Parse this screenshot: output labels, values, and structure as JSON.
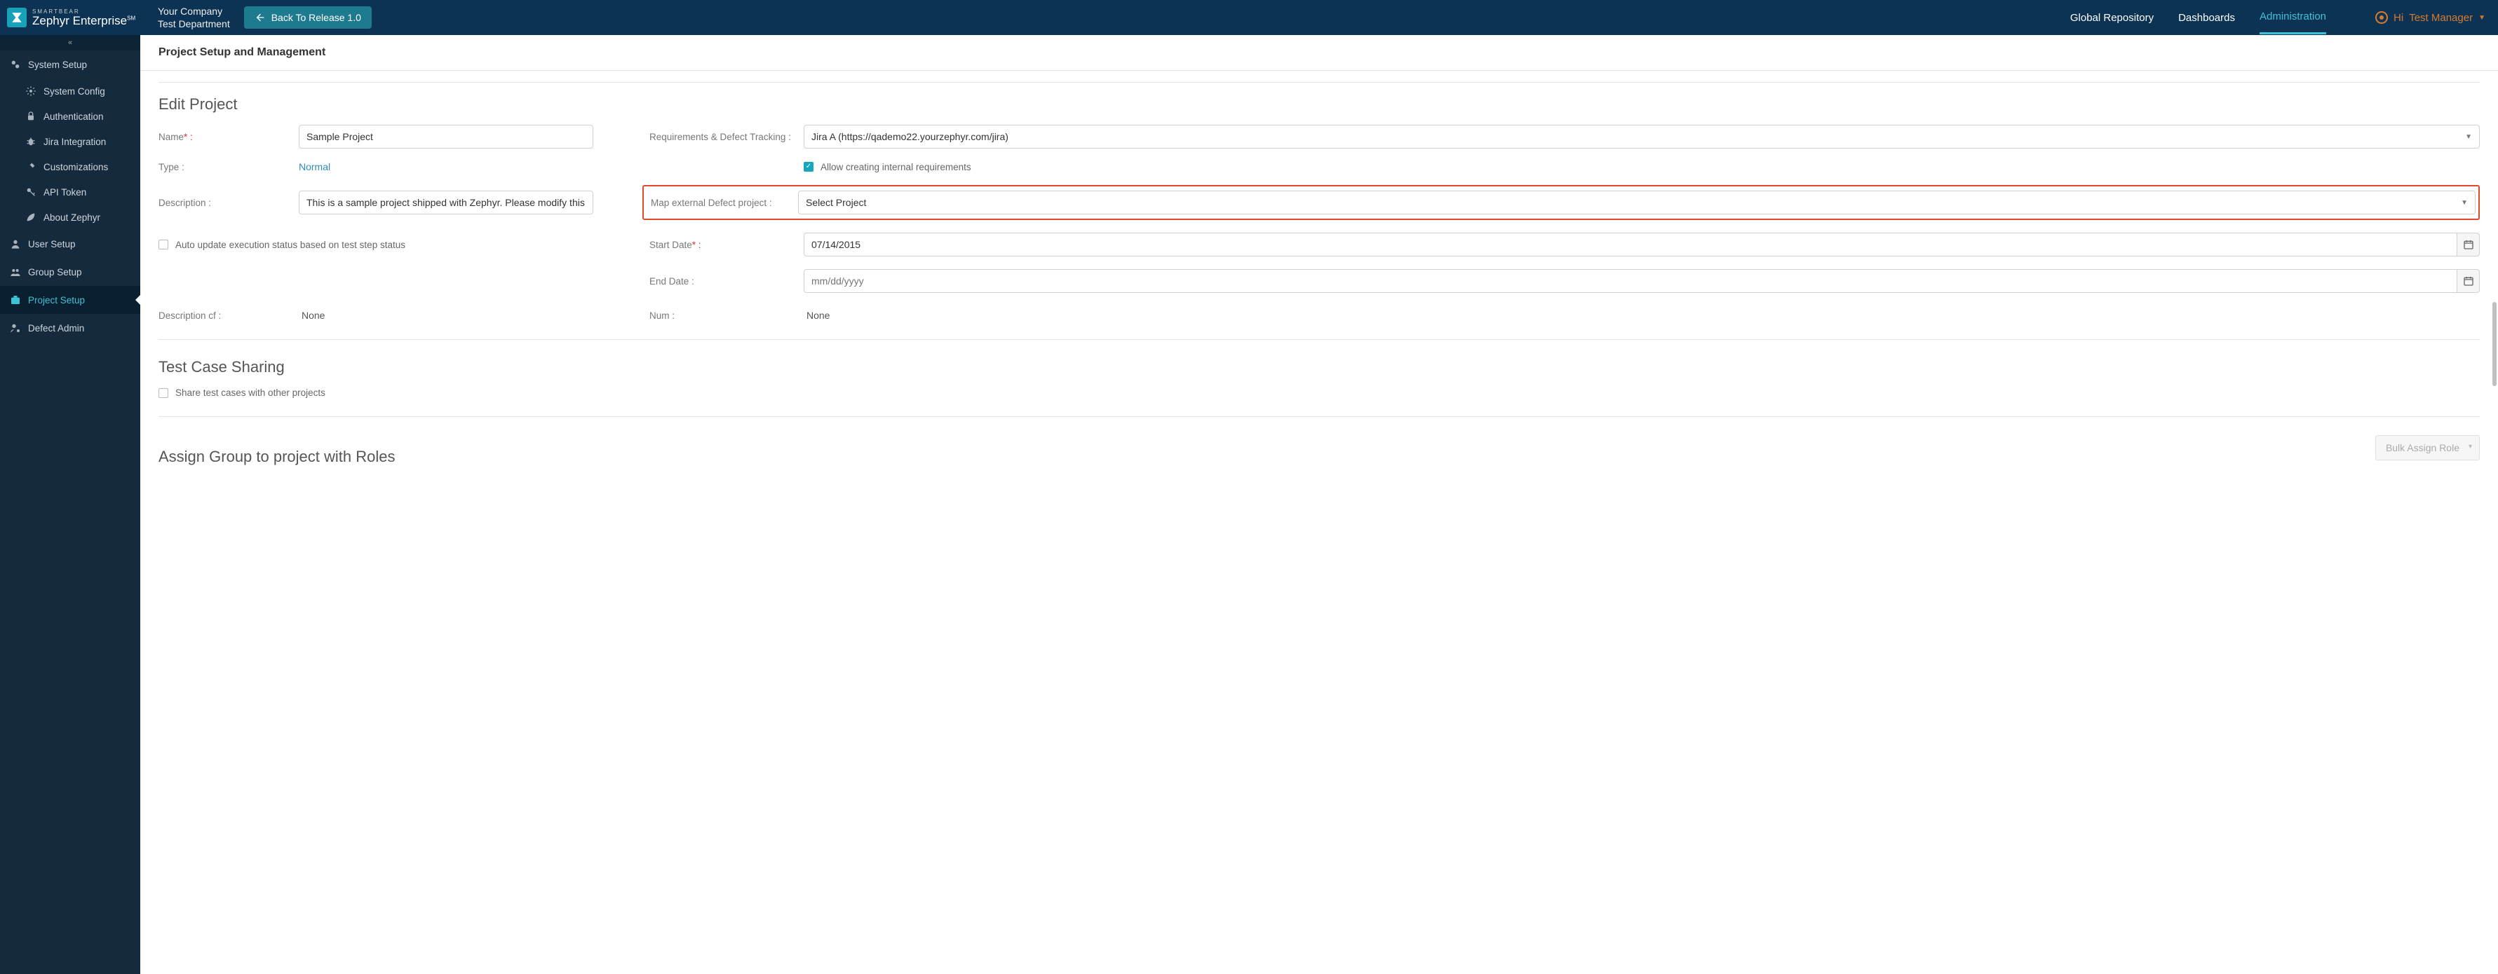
{
  "brand": {
    "small": "SMARTBEAR",
    "name": "Zephyr Enterprise",
    "tm": "SM"
  },
  "company": {
    "line1": "Your Company",
    "line2": "Test Department"
  },
  "back_button": "Back To Release 1.0",
  "topnav": {
    "global_repo": "Global Repository",
    "dashboards": "Dashboards",
    "administration": "Administration"
  },
  "user": {
    "hi": "Hi",
    "name": "Test Manager"
  },
  "sidebar": {
    "system_setup": "System Setup",
    "system_config": "System Config",
    "authentication": "Authentication",
    "jira_integration": "Jira Integration",
    "customizations": "Customizations",
    "api_token": "API Token",
    "about_zephyr": "About Zephyr",
    "user_setup": "User Setup",
    "group_setup": "Group Setup",
    "project_setup": "Project Setup",
    "defect_admin": "Defect Admin"
  },
  "page_title": "Project Setup and Management",
  "edit_project": {
    "title": "Edit Project",
    "name_label": "Name",
    "name_value": "Sample Project",
    "type_label": "Type :",
    "type_value": "Normal",
    "description_label": "Description :",
    "description_value": "This is a sample project shipped with Zephyr. Please modify this one o",
    "auto_update_label": "Auto update execution status based on test step status",
    "req_track_label": "Requirements & Defect Tracking :",
    "req_track_value": "Jira A (https://qademo22.yourzephyr.com/jira)",
    "allow_internal_label": "Allow creating internal requirements",
    "map_ext_label": "Map external Defect project :",
    "map_ext_value": "Select Project",
    "start_date_label": "Start Date",
    "start_date_value": "07/14/2015",
    "end_date_label": "End Date :",
    "end_date_placeholder": "mm/dd/yyyy",
    "desc_cf_label": "Description cf :",
    "desc_cf_value": "None",
    "num_label": "Num :",
    "num_value": "None"
  },
  "sharing": {
    "title": "Test Case Sharing",
    "share_label": "Share test cases with other projects"
  },
  "assign": {
    "title": "Assign Group to project with Roles",
    "bulk_button": "Bulk Assign Role"
  },
  "colon_required": "* :"
}
